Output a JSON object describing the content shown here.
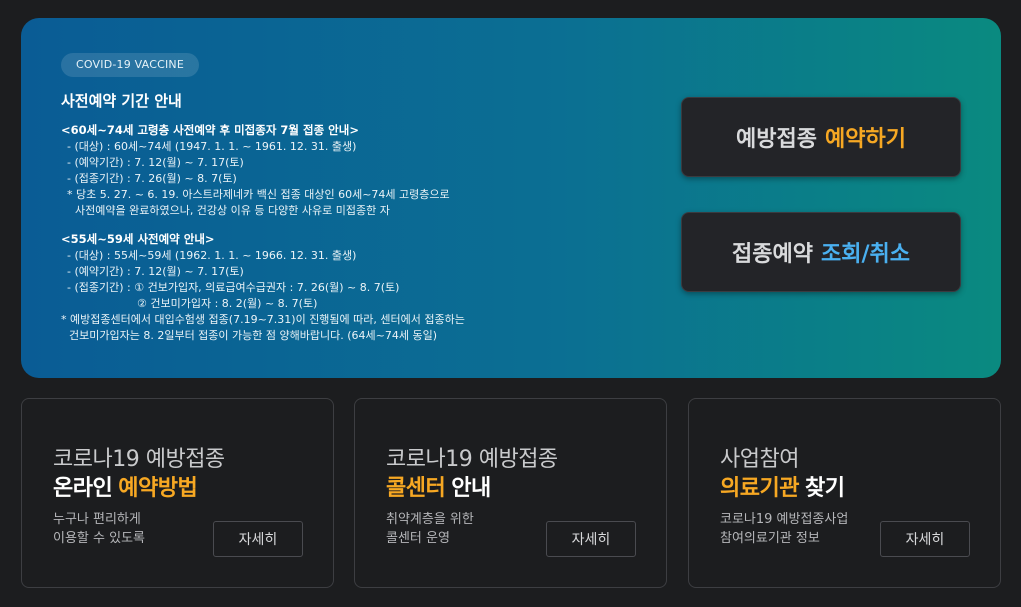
{
  "hero": {
    "pill": "COVID-19 VACCINE",
    "title": "사전예약 기간 안내",
    "section1": {
      "head": "<60세~74세 고령층 사전예약 후 미접종자 7월 접종 안내>",
      "lines": [
        "- (대상) : 60세~74세 (1947. 1. 1. ~ 1961. 12. 31. 출생)",
        "- (예약기간) : 7. 12(월) ~ 7. 17(토)",
        "- (접종기간) : 7. 26(월) ~ 8. 7(토)",
        "* 당초 5. 27. ~ 6. 19. 아스트라제네카 백신 접종 대상인 60세~74세 고령층으로",
        "사전예약을 완료하였으나, 건강상 이유 등 다양한 사유로 미접종한 자"
      ]
    },
    "section2": {
      "head": "<55세~59세 사전예약 안내>",
      "lines": [
        "- (대상) : 55세~59세 (1962. 1. 1. ~ 1966. 12. 31. 출생)",
        "- (예약기간) : 7. 12(월) ~ 7. 17(토)",
        "- (접종기간) : ① 건보가입자, 의료급여수급권자 : 7. 26(월) ~ 8. 7(토)",
        "② 건보미가입자 : 8. 2(월) ~ 8. 7(토)",
        "* 예방접종센터에서 대입수험생 접종(7.19~7.31)이 진행됨에 따라, 센터에서 접종하는",
        "건보미가입자는 8. 2일부터 접종이 가능한 점 양해바랍니다. (64세~74세 동일)"
      ]
    },
    "cta_reserve": {
      "text": "예방접종",
      "highlight": "예약하기"
    },
    "cta_check": {
      "text": "접종예약",
      "highlight": "조회/취소"
    }
  },
  "cards": [
    {
      "line1": "코로나19 예방접종",
      "line2_highlight": "온라인",
      "line2_highlight2": "예약방법",
      "desc1": "누구나 편리하게",
      "desc2": "이용할 수 있도록",
      "button": "자세히"
    },
    {
      "line1": "코로나19 예방접종",
      "line2_highlight": "콜센터",
      "line2_rest": "안내",
      "desc1": "취약계층을 위한",
      "desc2": "콜센터 운영",
      "button": "자세히"
    },
    {
      "line1": "사업참여",
      "line2_highlight": "의료기관",
      "line2_rest": "찾기",
      "desc1": "코로나19 예방접종사업",
      "desc2": "참여의료기관 정보",
      "button": "자세히"
    }
  ],
  "colors": {
    "accent_orange": "#f7a823",
    "accent_blue": "#4ab0f0",
    "hero_gradient_start": "#0a5c95",
    "hero_gradient_end": "#0a8a80",
    "background": "#1c1d1f"
  }
}
